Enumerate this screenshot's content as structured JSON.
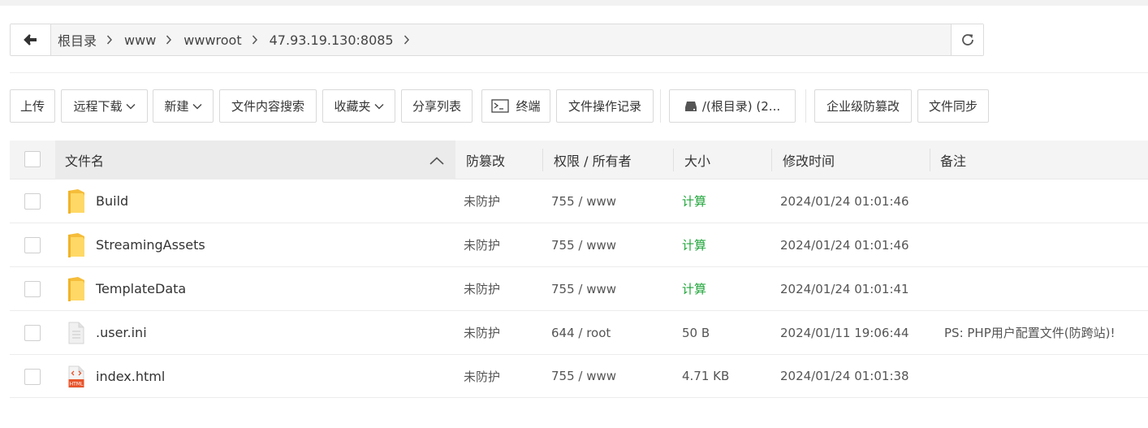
{
  "breadcrumbs": [
    {
      "label": "根目录"
    },
    {
      "label": "www"
    },
    {
      "label": "wwwroot"
    },
    {
      "label": "47.93.19.130:8085"
    }
  ],
  "toolbar": {
    "upload": "上传",
    "remote_download": "远程下载",
    "new": "新建",
    "content_search": "文件内容搜索",
    "favorites": "收藏夹",
    "share_list": "分享列表",
    "terminal": "终端",
    "operation_log": "文件操作记录",
    "disk": "/(根目录) (2...",
    "tamper_proof": "企业级防篡改",
    "file_sync": "文件同步"
  },
  "columns": {
    "name": "文件名",
    "tamper": "防篡改",
    "perm": "权限 / 所有者",
    "size": "大小",
    "mtime": "修改时间",
    "note": "备注"
  },
  "rows": [
    {
      "name": "Build",
      "type": "folder",
      "tamper": "未防护",
      "perm": "755 / www",
      "size": "计算",
      "mtime": "2024/01/24 01:01:46",
      "note": ""
    },
    {
      "name": "StreamingAssets",
      "type": "folder",
      "tamper": "未防护",
      "perm": "755 / www",
      "size": "计算",
      "mtime": "2024/01/24 01:01:46",
      "note": ""
    },
    {
      "name": "TemplateData",
      "type": "folder",
      "tamper": "未防护",
      "perm": "755 / www",
      "size": "计算",
      "mtime": "2024/01/24 01:01:41",
      "note": ""
    },
    {
      "name": ".user.ini",
      "type": "ini",
      "tamper": "未防护",
      "perm": "644 / root",
      "size": "50 B",
      "mtime": "2024/01/11 19:06:44",
      "note": "PS: PHP用户配置文件(防跨站)!"
    },
    {
      "name": "index.html",
      "type": "html",
      "tamper": "未防护",
      "perm": "755 / www",
      "size": "4.71 KB",
      "mtime": "2024/01/24 01:01:38",
      "note": ""
    }
  ],
  "icons": {
    "back": "arrow-left-icon",
    "refresh": "refresh-icon",
    "terminal": "terminal-icon",
    "disk": "disk-icon",
    "sort": "sort-up-icon",
    "folder": "folder-icon",
    "ini": "document-icon",
    "html": "html-file-icon",
    "html_badge": "HTML"
  },
  "colors": {
    "accent_green": "#20a53a",
    "folder": "#f7c84a",
    "html_badge": "#e8532a"
  }
}
